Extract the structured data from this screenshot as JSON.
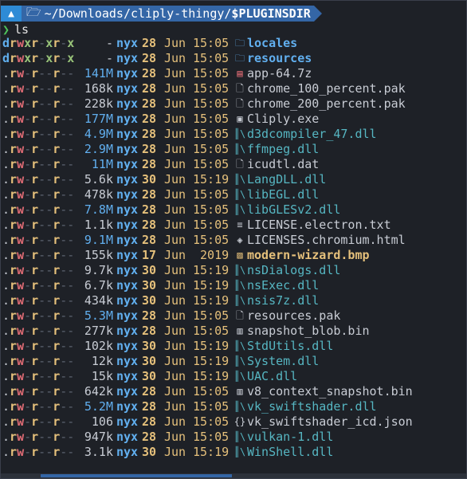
{
  "prompt": {
    "os_icon": "arch-icon",
    "folder_icon": "folder-icon",
    "path_prefix": "~/Downloads/cliply-thingy/",
    "path_bold": "$PLUGINSDIR"
  },
  "command": {
    "chevron": "❯",
    "text": "ls"
  },
  "colors": {
    "dir": "#61afef",
    "dll": "#56b6c2",
    "archive": "#e06c75",
    "image": "#e5c07b",
    "date": "#e5c07b",
    "user": "#61afef"
  },
  "files": [
    {
      "perm": "drwxr-xr-x",
      "size": "-",
      "user": "nyx",
      "day": "28",
      "mon": "Jun",
      "time": "15:05",
      "icon": "folder-icon",
      "name": "locales",
      "kind": "dir",
      "size_color": "#c8ccd4"
    },
    {
      "perm": "drwxr-xr-x",
      "size": "-",
      "user": "nyx",
      "day": "28",
      "mon": "Jun",
      "time": "15:05",
      "icon": "folder-icon",
      "name": "resources",
      "kind": "dir",
      "size_color": "#c8ccd4"
    },
    {
      "perm": ".rw-r--r--",
      "size": "141M",
      "user": "nyx",
      "day": "28",
      "mon": "Jun",
      "time": "15:05",
      "icon": "archive-icon",
      "name": "app-64.7z",
      "kind": "archive",
      "size_color": "#61afef"
    },
    {
      "perm": ".rw-r--r--",
      "size": "168k",
      "user": "nyx",
      "day": "28",
      "mon": "Jun",
      "time": "15:05",
      "icon": "file-icon",
      "name": "chrome_100_percent.pak",
      "kind": "file",
      "size_color": "#c8ccd4"
    },
    {
      "perm": ".rw-r--r--",
      "size": "228k",
      "user": "nyx",
      "day": "28",
      "mon": "Jun",
      "time": "15:05",
      "icon": "file-icon",
      "name": "chrome_200_percent.pak",
      "kind": "file",
      "size_color": "#c8ccd4"
    },
    {
      "perm": ".rw-r--r--",
      "size": "177M",
      "user": "nyx",
      "day": "28",
      "mon": "Jun",
      "time": "15:05",
      "icon": "window-icon",
      "name": "Cliply.exe",
      "kind": "file",
      "size_color": "#61afef"
    },
    {
      "perm": ".rw-r--r--",
      "size": "4.9M",
      "user": "nyx",
      "day": "28",
      "mon": "Jun",
      "time": "15:05",
      "icon": "library-icon",
      "name": "d3dcompiler_47.dll",
      "kind": "dll",
      "size_color": "#61afef"
    },
    {
      "perm": ".rw-r--r--",
      "size": "2.9M",
      "user": "nyx",
      "day": "28",
      "mon": "Jun",
      "time": "15:05",
      "icon": "library-icon",
      "name": "ffmpeg.dll",
      "kind": "dll",
      "size_color": "#61afef"
    },
    {
      "perm": ".rw-r--r--",
      "size": "11M",
      "user": "nyx",
      "day": "28",
      "mon": "Jun",
      "time": "15:05",
      "icon": "file-icon",
      "name": "icudtl.dat",
      "kind": "file",
      "size_color": "#61afef"
    },
    {
      "perm": ".rw-r--r--",
      "size": "5.6k",
      "user": "nyx",
      "day": "30",
      "mon": "Jun",
      "time": "15:19",
      "icon": "library-icon",
      "name": "LangDLL.dll",
      "kind": "dll",
      "size_color": "#c8ccd4"
    },
    {
      "perm": ".rw-r--r--",
      "size": "478k",
      "user": "nyx",
      "day": "28",
      "mon": "Jun",
      "time": "15:05",
      "icon": "library-icon",
      "name": "libEGL.dll",
      "kind": "dll",
      "size_color": "#c8ccd4"
    },
    {
      "perm": ".rw-r--r--",
      "size": "7.8M",
      "user": "nyx",
      "day": "28",
      "mon": "Jun",
      "time": "15:05",
      "icon": "library-icon",
      "name": "libGLESv2.dll",
      "kind": "dll",
      "size_color": "#61afef"
    },
    {
      "perm": ".rw-r--r--",
      "size": "1.1k",
      "user": "nyx",
      "day": "28",
      "mon": "Jun",
      "time": "15:05",
      "icon": "license-icon",
      "name": "LICENSE.electron.txt",
      "kind": "file",
      "size_color": "#c8ccd4"
    },
    {
      "perm": ".rw-r--r--",
      "size": "9.1M",
      "user": "nyx",
      "day": "28",
      "mon": "Jun",
      "time": "15:05",
      "icon": "html-icon",
      "name": "LICENSES.chromium.html",
      "kind": "file",
      "size_color": "#61afef"
    },
    {
      "perm": ".rw-r--r--",
      "size": "155k",
      "user": "nyx",
      "day": "17",
      "mon": "Jun",
      "time": " 2019",
      "icon": "image-icon",
      "name": "modern-wizard.bmp",
      "kind": "image",
      "size_color": "#c8ccd4"
    },
    {
      "perm": ".rw-r--r--",
      "size": "9.7k",
      "user": "nyx",
      "day": "30",
      "mon": "Jun",
      "time": "15:19",
      "icon": "library-icon",
      "name": "nsDialogs.dll",
      "kind": "dll",
      "size_color": "#c8ccd4"
    },
    {
      "perm": ".rw-r--r--",
      "size": "6.7k",
      "user": "nyx",
      "day": "30",
      "mon": "Jun",
      "time": "15:19",
      "icon": "library-icon",
      "name": "nsExec.dll",
      "kind": "dll",
      "size_color": "#c8ccd4"
    },
    {
      "perm": ".rw-r--r--",
      "size": "434k",
      "user": "nyx",
      "day": "30",
      "mon": "Jun",
      "time": "15:19",
      "icon": "library-icon",
      "name": "nsis7z.dll",
      "kind": "dll",
      "size_color": "#c8ccd4"
    },
    {
      "perm": ".rw-r--r--",
      "size": "5.3M",
      "user": "nyx",
      "day": "28",
      "mon": "Jun",
      "time": "15:05",
      "icon": "file-icon",
      "name": "resources.pak",
      "kind": "file",
      "size_color": "#61afef"
    },
    {
      "perm": ".rw-r--r--",
      "size": "277k",
      "user": "nyx",
      "day": "28",
      "mon": "Jun",
      "time": "15:05",
      "icon": "binary-icon",
      "name": "snapshot_blob.bin",
      "kind": "file",
      "size_color": "#c8ccd4"
    },
    {
      "perm": ".rw-r--r--",
      "size": "102k",
      "user": "nyx",
      "day": "30",
      "mon": "Jun",
      "time": "15:19",
      "icon": "library-icon",
      "name": "StdUtils.dll",
      "kind": "dll",
      "size_color": "#c8ccd4"
    },
    {
      "perm": ".rw-r--r--",
      "size": "12k",
      "user": "nyx",
      "day": "30",
      "mon": "Jun",
      "time": "15:19",
      "icon": "library-icon",
      "name": "System.dll",
      "kind": "dll",
      "size_color": "#c8ccd4"
    },
    {
      "perm": ".rw-r--r--",
      "size": "15k",
      "user": "nyx",
      "day": "30",
      "mon": "Jun",
      "time": "15:19",
      "icon": "library-icon",
      "name": "UAC.dll",
      "kind": "dll",
      "size_color": "#c8ccd4"
    },
    {
      "perm": ".rw-r--r--",
      "size": "642k",
      "user": "nyx",
      "day": "28",
      "mon": "Jun",
      "time": "15:05",
      "icon": "binary-icon",
      "name": "v8_context_snapshot.bin",
      "kind": "file",
      "size_color": "#c8ccd4"
    },
    {
      "perm": ".rw-r--r--",
      "size": "5.2M",
      "user": "nyx",
      "day": "28",
      "mon": "Jun",
      "time": "15:05",
      "icon": "library-icon",
      "name": "vk_swiftshader.dll",
      "kind": "dll",
      "size_color": "#61afef"
    },
    {
      "perm": ".rw-r--r--",
      "size": "106",
      "user": "nyx",
      "day": "28",
      "mon": "Jun",
      "time": "15:05",
      "icon": "json-icon",
      "name": "vk_swiftshader_icd.json",
      "kind": "file",
      "size_color": "#c8ccd4"
    },
    {
      "perm": ".rw-r--r--",
      "size": "947k",
      "user": "nyx",
      "day": "28",
      "mon": "Jun",
      "time": "15:05",
      "icon": "library-icon",
      "name": "vulkan-1.dll",
      "kind": "dll",
      "size_color": "#c8ccd4"
    },
    {
      "perm": ".rw-r--r--",
      "size": "3.1k",
      "user": "nyx",
      "day": "30",
      "mon": "Jun",
      "time": "15:19",
      "icon": "library-icon",
      "name": "WinShell.dll",
      "kind": "dll",
      "size_color": "#c8ccd4"
    }
  ]
}
